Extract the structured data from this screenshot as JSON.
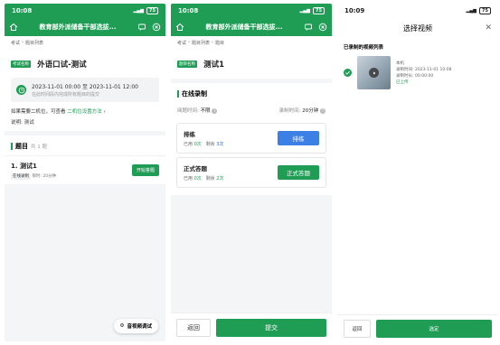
{
  "colors": {
    "accent": "#1f9d55",
    "blue": "#3c80e6"
  },
  "screen1": {
    "time": "10:08",
    "battery": "75",
    "nav_title": "教育部外派储备干部选拔...",
    "breadcrumb": [
      "考试",
      "题目列表"
    ],
    "exam_tag": "考试名称",
    "exam_name": "外语口试-测试",
    "time_range": "2023-11-01 00:00 至 2023-11-01 12:00",
    "time_note": "在此时间段内完成所有题目的提交",
    "second_device_text": "如果需要二机位，可查看",
    "second_device_link": "二机位设置方法",
    "desc_label": "说明:",
    "desc_value": "测试",
    "section_title": "题目",
    "section_count": "共 1 题",
    "question": {
      "name": "1. 测试1",
      "type": "在线录制",
      "limit_label": "限时:",
      "limit_value": "20分钟",
      "start_button": "开始答题"
    },
    "av_debug_button": "音视频调试"
  },
  "screen2": {
    "time": "10:08",
    "battery": "75",
    "nav_title": "教育部外派储备干部选拔...",
    "breadcrumb": [
      "考试",
      "题目列表",
      "题目"
    ],
    "tag": "题目名称",
    "title": "测试1",
    "section_title": "在线录制",
    "read_time_label": "阅题时间:",
    "read_time_value": "不限",
    "record_time_label": "录制时间:",
    "record_time_value": "20分钟",
    "tasks": [
      {
        "name": "排练",
        "used_label": "已用",
        "used": "0次",
        "left_label": "剩余",
        "left": "3次",
        "button": "排练"
      },
      {
        "name": "正式答题",
        "used_label": "已用",
        "used": "0次",
        "left_label": "剩余",
        "left": "2次",
        "button": "正式答题"
      }
    ],
    "back_button": "返回",
    "submit_button": "提交"
  },
  "screen3": {
    "time": "10:09",
    "battery": "75",
    "title": "选择视频",
    "list_title": "已录制的视频列表",
    "video": {
      "source": "本机",
      "recorded_label": "录制时间:",
      "recorded_value": "2023-11-01 10:08",
      "duration_label": "录制时长:",
      "duration_value": "00:00:00",
      "status": "已上传"
    },
    "back_button": "返回",
    "select_button": "选定"
  }
}
